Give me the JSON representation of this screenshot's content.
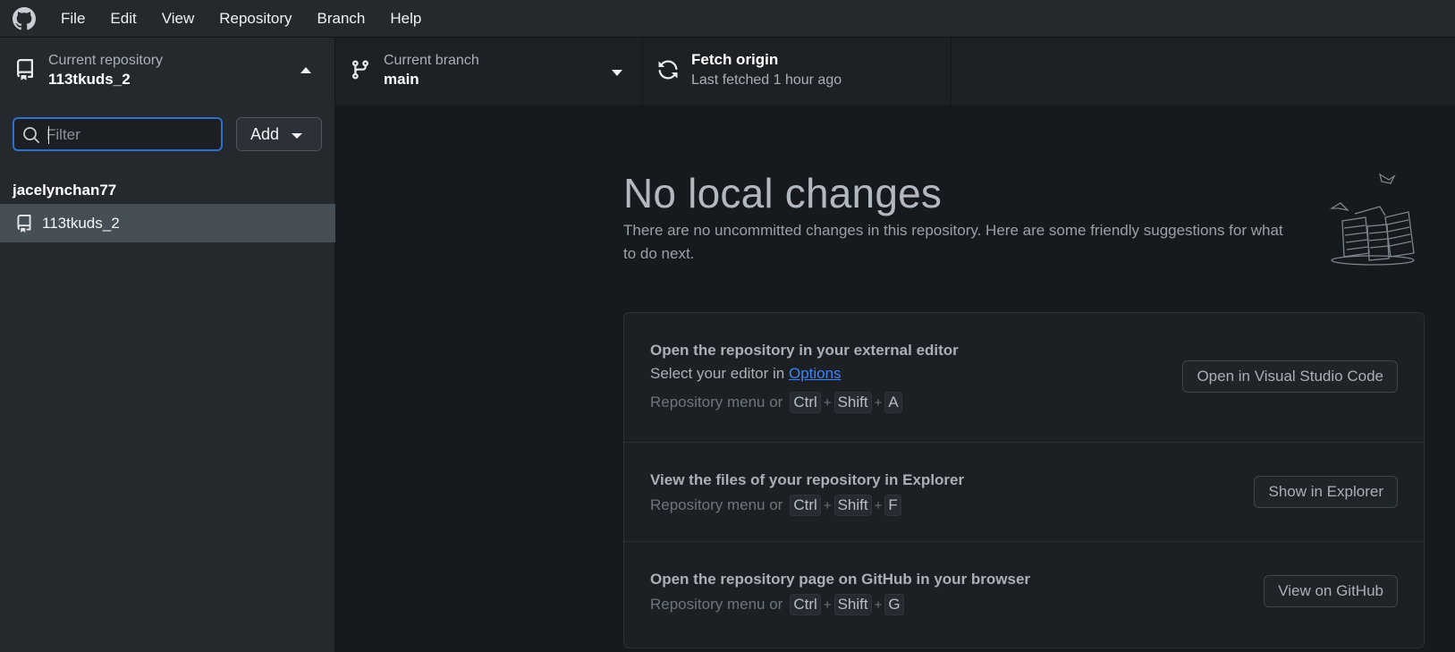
{
  "menu": {
    "logo_icon": "github-mark-icon",
    "items": [
      "File",
      "Edit",
      "View",
      "Repository",
      "Branch",
      "Help"
    ]
  },
  "toolbar": {
    "repository": {
      "label": "Current repository",
      "value": "113tkuds_2",
      "icon": "repo-icon"
    },
    "branch": {
      "label": "Current branch",
      "value": "main",
      "icon": "git-branch-icon"
    },
    "fetch": {
      "title": "Fetch origin",
      "subtitle": "Last fetched 1 hour ago",
      "icon": "sync-icon"
    }
  },
  "sidebar": {
    "filter_placeholder": "Filter",
    "add_label": "Add",
    "group": "jacelynchan77",
    "repos": [
      {
        "name": "113tkuds_2",
        "selected": true
      }
    ]
  },
  "main": {
    "title": "No local changes",
    "description": "There are no uncommitted changes in this repository. Here are some friendly suggestions for what to do next.",
    "suggestions": [
      {
        "title": "Open the repository in your external editor",
        "subtitle_prefix": "Select your editor in ",
        "subtitle_link": "Options",
        "menu_text": "Repository menu or",
        "keys": [
          "Ctrl",
          "Shift",
          "A"
        ],
        "button": "Open in Visual Studio Code"
      },
      {
        "title": "View the files of your repository in Explorer",
        "menu_text": "Repository menu or",
        "keys": [
          "Ctrl",
          "Shift",
          "F"
        ],
        "button": "Show in Explorer"
      },
      {
        "title": "Open the repository page on GitHub in your browser",
        "menu_text": "Repository menu or",
        "keys": [
          "Ctrl",
          "Shift",
          "G"
        ],
        "button": "View on GitHub"
      }
    ]
  },
  "colors": {
    "accent": "#316dca",
    "link": "#3b82f6",
    "toolbar_bg": "#24292e",
    "main_bg": "#16191d",
    "selected_row": "#464e56"
  }
}
